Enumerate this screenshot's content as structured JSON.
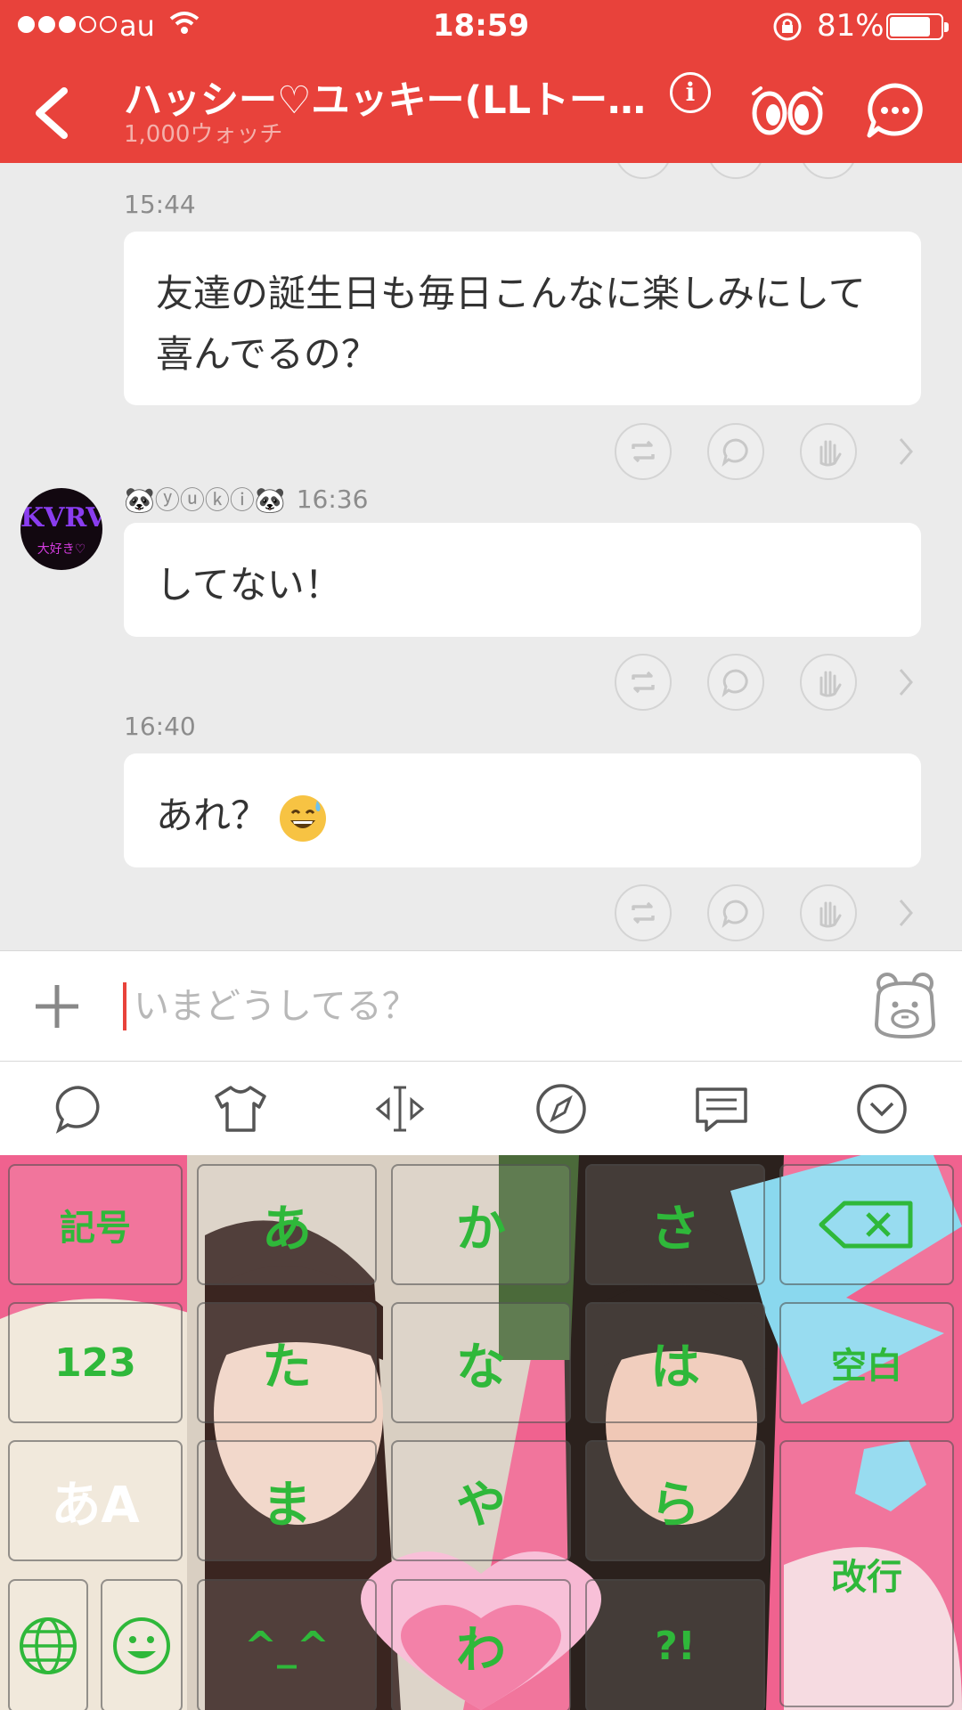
{
  "status_bar": {
    "carrier": "au",
    "time": "18:59",
    "battery_percent": "81%",
    "battery_level": 0.81,
    "signal_bars": 3
  },
  "header": {
    "title": "ハッシー♡ユッキー(LLトー…",
    "subtitle": "1,000ウォッチ",
    "info_label": "i"
  },
  "messages": [
    {
      "time": "15:44",
      "text": "友達の誕生日も毎日こんなに楽しみにして喜んでるの？"
    },
    {
      "sender": "🐼ⓨⓤⓚⓘ🐼",
      "time": "16:36",
      "text": "してない！",
      "avatar_text_top": "KVRVY",
      "avatar_text_bottom": "大好き♡"
    },
    {
      "time": "16:40",
      "text": "あれ？"
    }
  ],
  "input": {
    "placeholder": "いまどうしてる？"
  },
  "toolbar": [
    "bubble-icon",
    "tshirt-icon",
    "cursor-move-icon",
    "compass-icon",
    "message-icon",
    "chevron-down-circle-icon"
  ],
  "keyboard": {
    "symbols": "記号",
    "numbers": "123",
    "mode": "あA",
    "row1": [
      "あ",
      "か",
      "さ"
    ],
    "row2": [
      "た",
      "な",
      "は"
    ],
    "row3": [
      "ま",
      "や",
      "ら"
    ],
    "row4_face": "^_^",
    "row4_wa": "わ",
    "row4_punct": "?!",
    "space": "空白",
    "enter": "改行",
    "accent_color": "#2fb83a"
  }
}
